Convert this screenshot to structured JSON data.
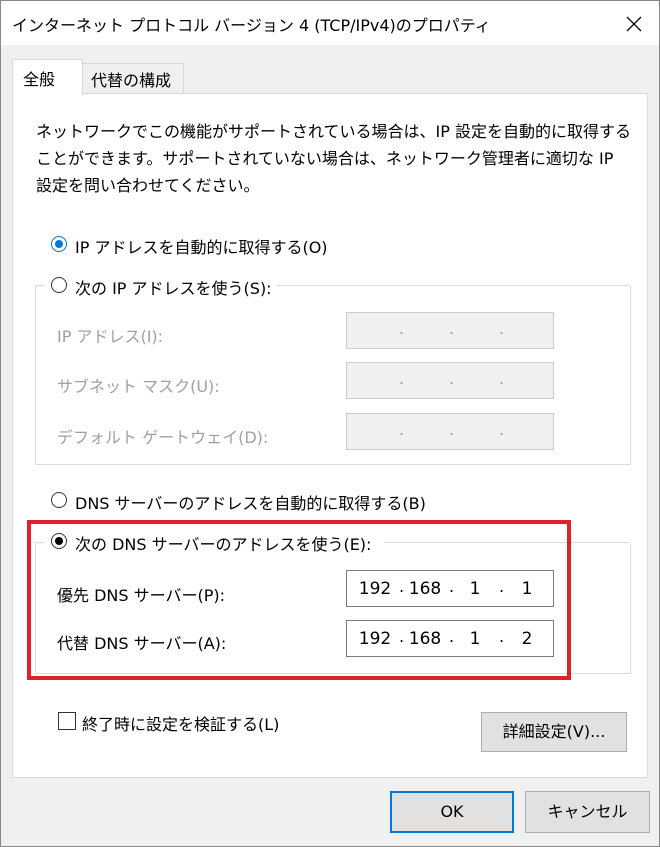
{
  "window": {
    "title": "インターネット プロトコル バージョン 4 (TCP/IPv4)のプロパティ"
  },
  "tabs": [
    {
      "label": "全般"
    },
    {
      "label": "代替の構成"
    }
  ],
  "description": "ネットワークでこの機能がサポートされている場合は、IP 設定を自動的に取得することができます。サポートされていない場合は、ネットワーク管理者に適切な IP 設定を問い合わせてください。",
  "ip": {
    "auto_label": "IP アドレスを自動的に取得する(O)",
    "manual_label": "次の IP アドレスを使う(S):",
    "fields": [
      {
        "label": "IP アドレス(I):",
        "octets": [
          "",
          "",
          "",
          ""
        ]
      },
      {
        "label": "サブネット マスク(U):",
        "octets": [
          "",
          "",
          "",
          ""
        ]
      },
      {
        "label": "デフォルト ゲートウェイ(D):",
        "octets": [
          "",
          "",
          "",
          ""
        ]
      }
    ]
  },
  "dns": {
    "auto_label": "DNS サーバーのアドレスを自動的に取得する(B)",
    "manual_label": "次の DNS サーバーのアドレスを使う(E):",
    "preferred": {
      "label": "優先 DNS サーバー(P):",
      "octets": [
        "192",
        "168",
        "1",
        "1"
      ]
    },
    "alternate": {
      "label": "代替 DNS サーバー(A):",
      "octets": [
        "192",
        "168",
        "1",
        "2"
      ]
    }
  },
  "validate_label": "終了時に設定を検証する(L)",
  "buttons": {
    "advanced": "詳細設定(V)...",
    "ok": "OK",
    "cancel": "キャンセル"
  },
  "colors": {
    "accent": "#0078d7",
    "highlight": "#e0202a"
  }
}
